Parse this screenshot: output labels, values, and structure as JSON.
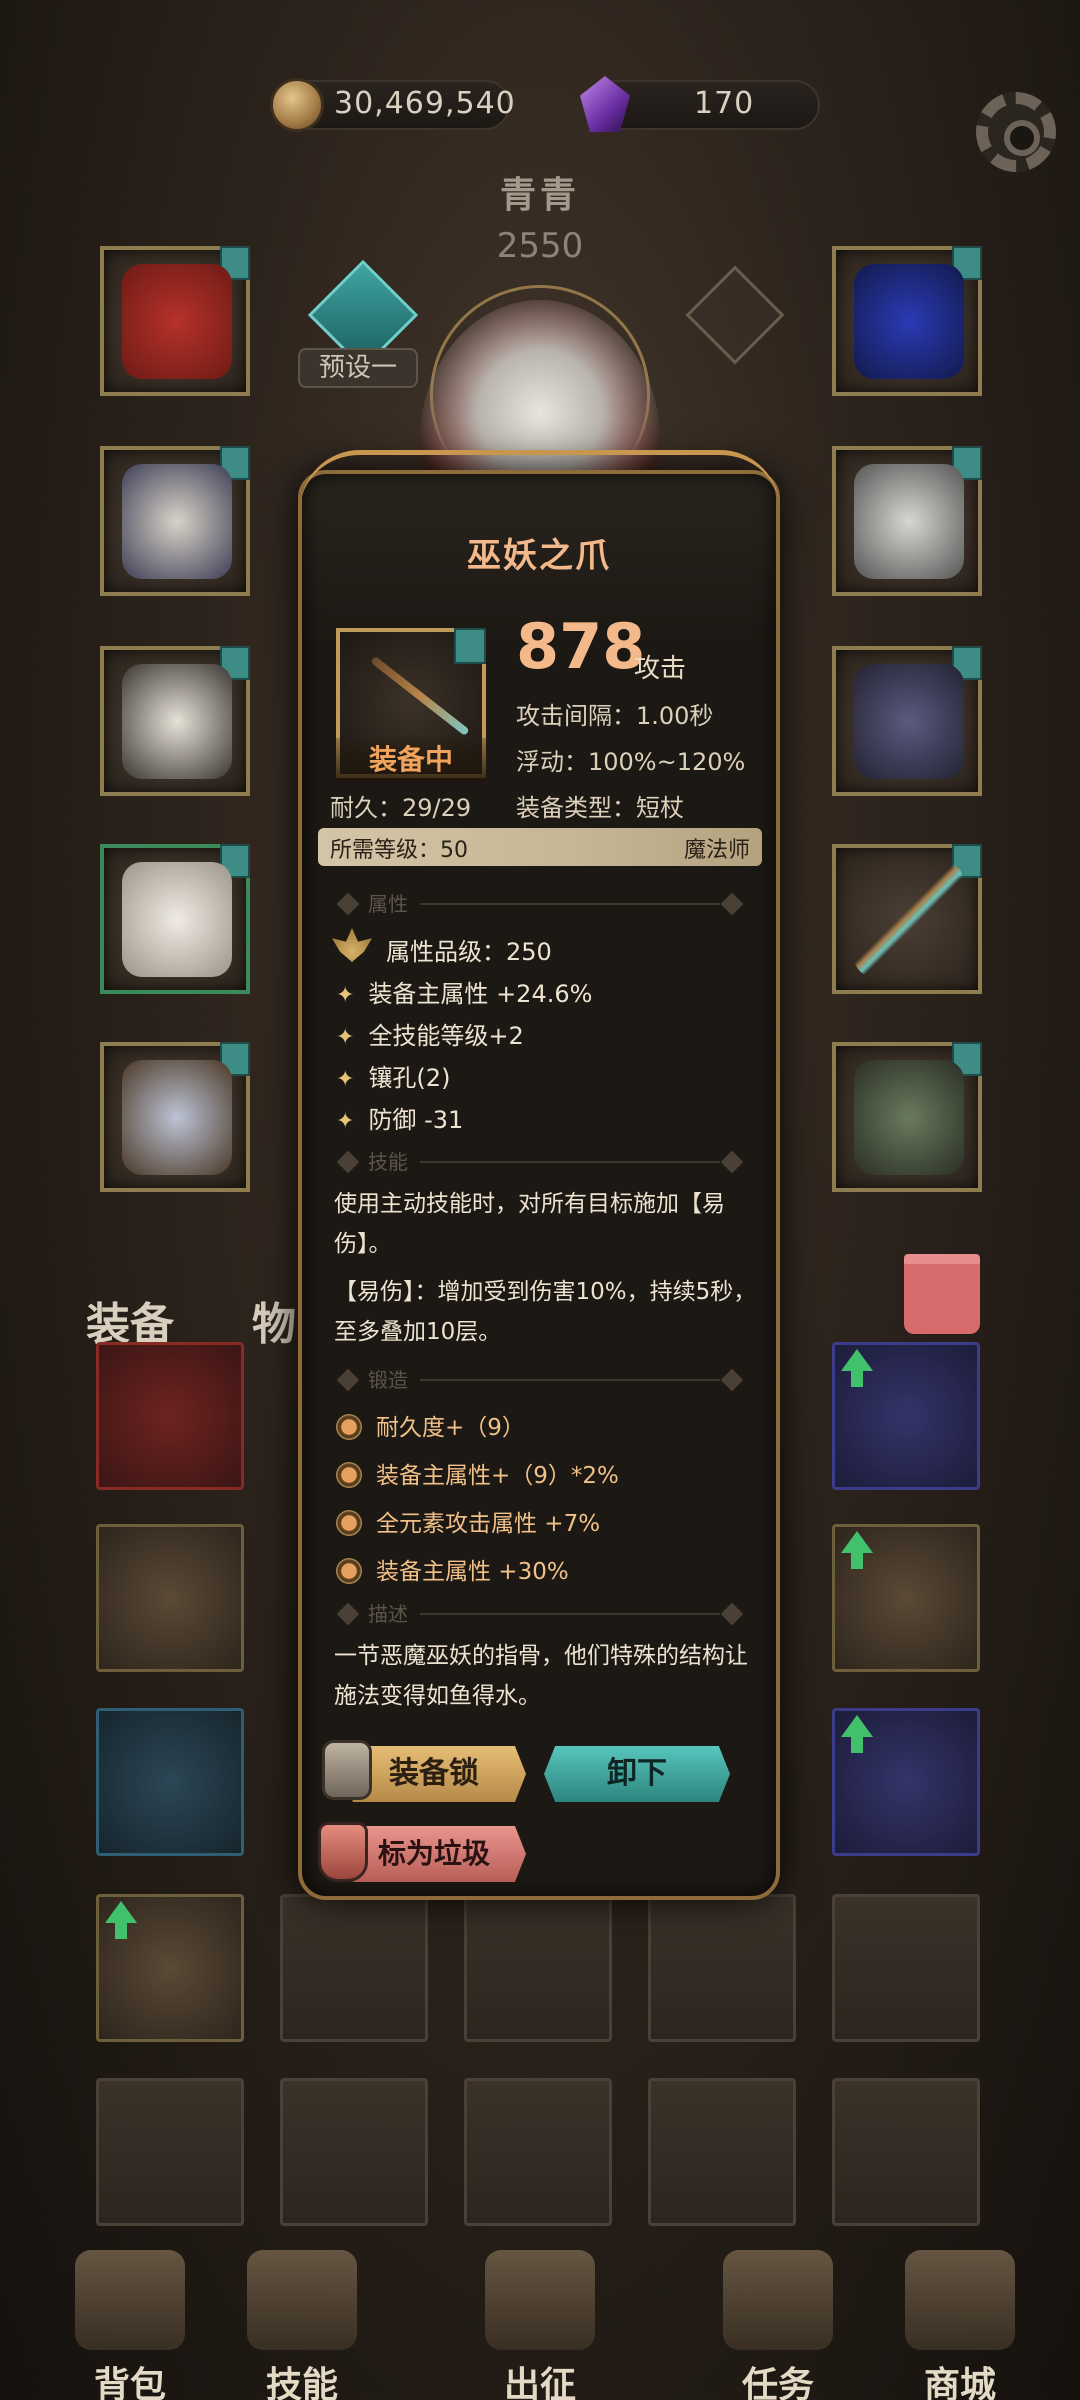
{
  "resources": {
    "gold": "30,469,540",
    "gems": "170"
  },
  "hero": {
    "name": "青青",
    "power": "2550",
    "preset_label": "预设一"
  },
  "tabs": {
    "equipment": "装备",
    "items": "物品"
  },
  "popup": {
    "title": "巫妖之爪",
    "equipped_badge": "装备中",
    "attack_value": "878",
    "attack_unit": "攻击",
    "attack_interval": "攻击间隔：1.00秒",
    "variance": "浮动：100%~120%",
    "durability": "耐久：29/29",
    "equip_type": "装备类型：短杖",
    "required_level": "所需等级：50",
    "class": "魔法师",
    "sections": {
      "attributes": "属性",
      "skill": "技能",
      "forge": "锻造",
      "description": "描述"
    },
    "attr_grade": "属性品级：250",
    "attributes": [
      "装备主属性 +24.6%",
      "全技能等级+2",
      "镶孔(2)",
      "防御 -31"
    ],
    "skill_text_1": "使用主动技能时，对所有目标施加【易伤】。",
    "skill_text_2": "【易伤】：增加受到伤害10%，持续5秒，至多叠加10层。",
    "forge": [
      "耐久度+（9）",
      "装备主属性+（9）*2%",
      "全元素攻击属性 +7%",
      "装备主属性 +30%"
    ],
    "description": "一节恶魔巫妖的指骨，他们特殊的结构让施法变得如鱼得水。",
    "buttons": {
      "lock": "装备锁",
      "unequip": "卸下",
      "junk": "标为垃圾"
    }
  },
  "nav": [
    {
      "label": "背包",
      "icon": "backpack-icon"
    },
    {
      "label": "技能",
      "icon": "skill-book-icon"
    },
    {
      "label": "出征",
      "icon": "sword-map-icon"
    },
    {
      "label": "任务",
      "icon": "quest-scroll-icon"
    },
    {
      "label": "商城",
      "icon": "shop-crown-icon"
    }
  ],
  "colors": {
    "accent_gold": "#f4b98a",
    "teal": "#3d8c86",
    "upgrade_green": "#41c16b"
  }
}
